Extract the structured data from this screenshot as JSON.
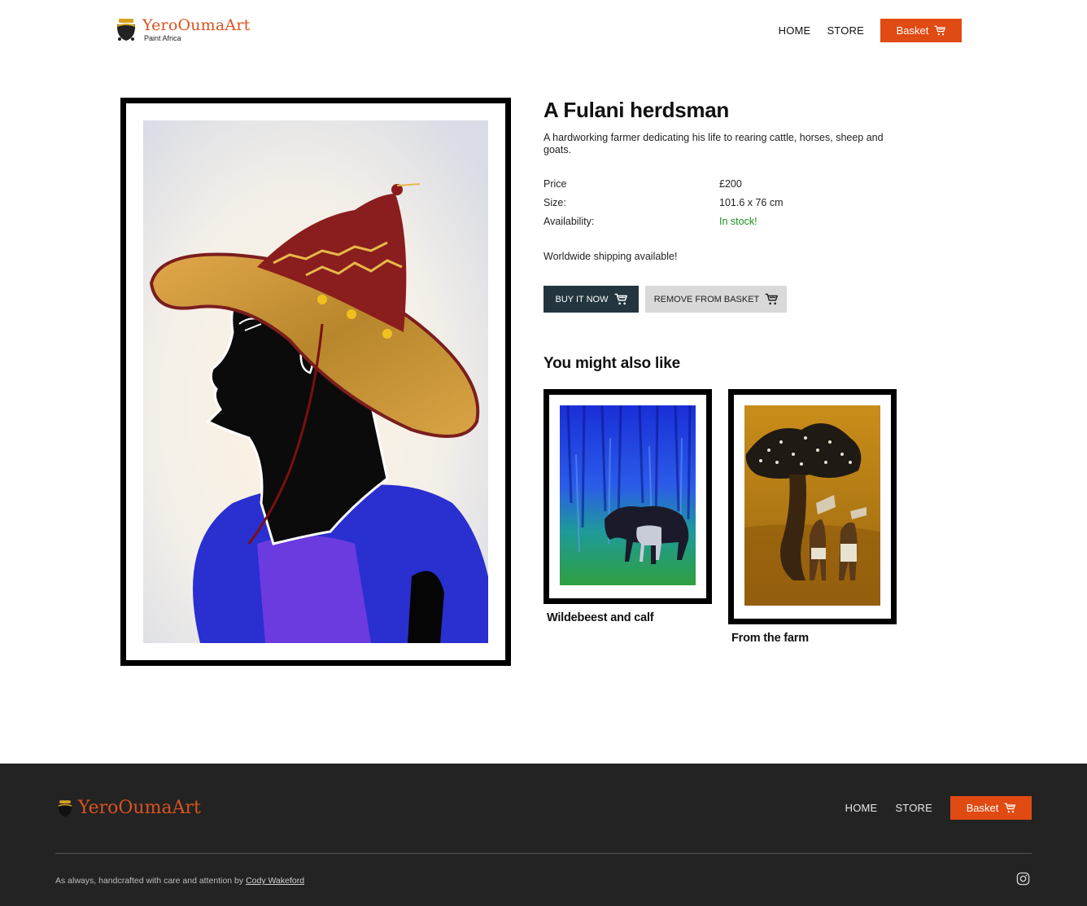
{
  "header": {
    "logo_name": "YeroOumaArt",
    "logo_tagline": "Paint Africa",
    "nav": [
      "HOME",
      "STORE"
    ],
    "basket_label": "Basket"
  },
  "product": {
    "title": "A Fulani herdsman",
    "description": "A hardworking farmer dedicating his life to rearing cattle, horses, sheep and goats.",
    "specs": [
      {
        "label": "Price",
        "value": "£200"
      },
      {
        "label": "Size:",
        "value": "101.6 x 76 cm"
      },
      {
        "label": "Availability:",
        "value": "In stock!"
      }
    ],
    "shipping": "Worldwide shipping available!",
    "buy_label": "BUY IT NOW",
    "remove_label": "REMOVE FROM BASKET"
  },
  "recommendations": {
    "heading": "You might also like",
    "items": [
      {
        "title": "Wildebeest and calf"
      },
      {
        "title": "From the farm"
      }
    ]
  },
  "footer": {
    "logo_name": "YeroOumaArt",
    "nav": [
      "HOME",
      "STORE"
    ],
    "basket_label": "Basket",
    "credit_text": "As always, handcrafted with care and attention by",
    "credit_author": "Cody Wakeford"
  },
  "colors": {
    "accent": "#e04a13",
    "dark_button": "#23363f",
    "footer_bg": "#232323",
    "in_stock": "#1e8f1e"
  },
  "icons": [
    "cart-icon",
    "instagram-icon",
    "pot-logo-icon"
  ]
}
